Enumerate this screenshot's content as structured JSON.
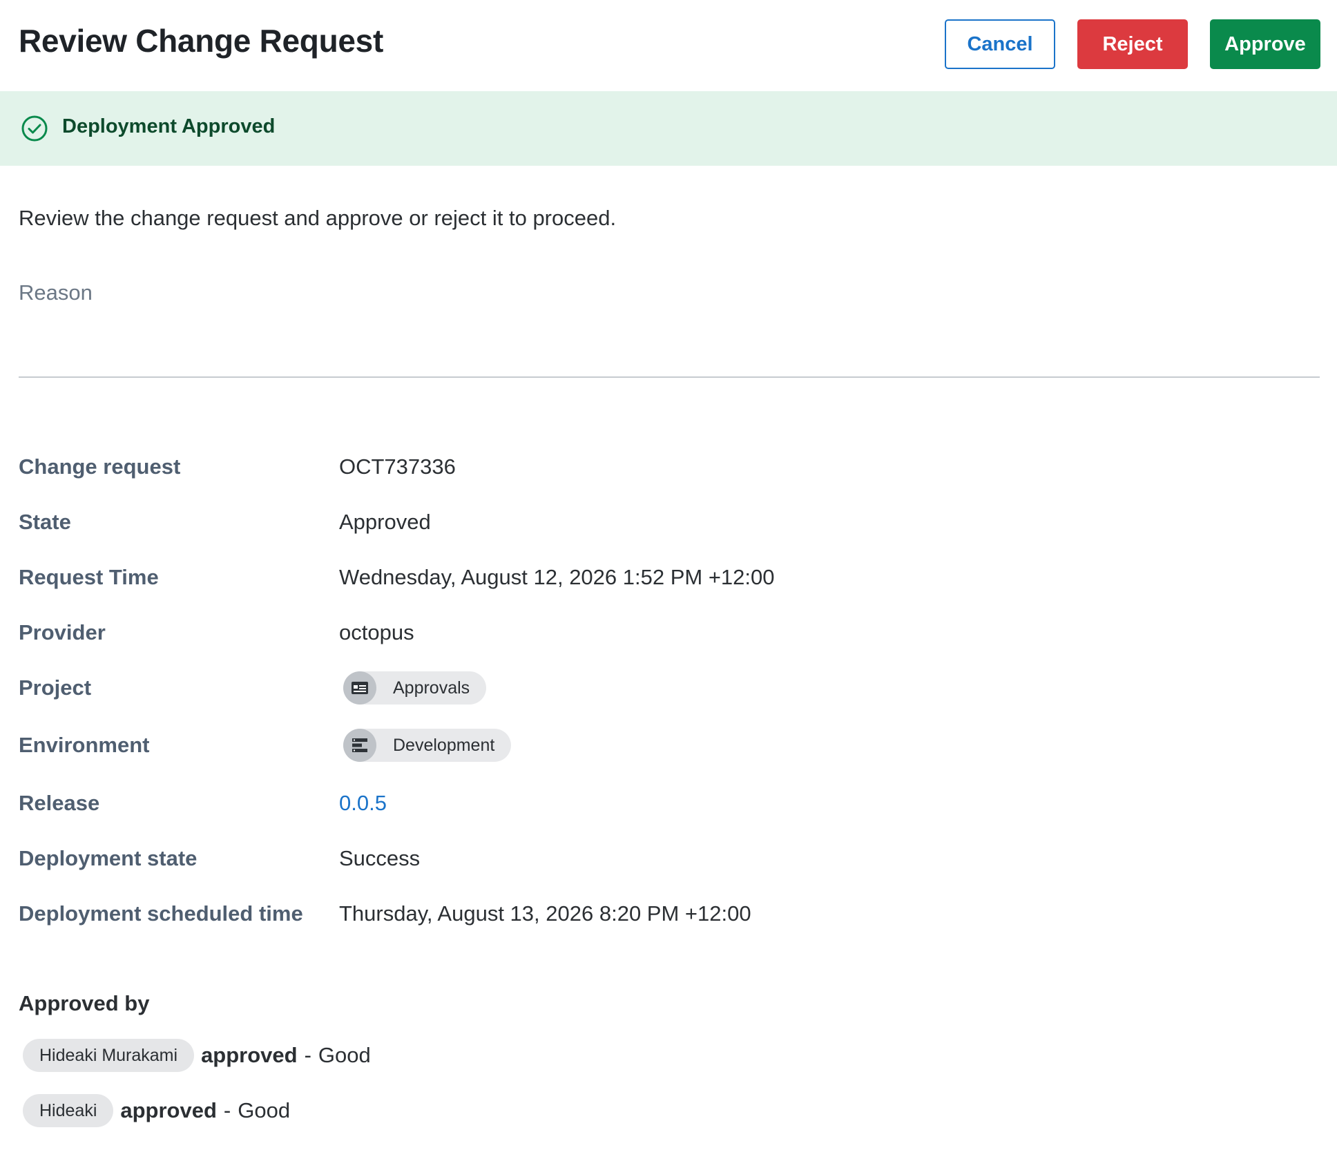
{
  "header": {
    "title": "Review Change Request",
    "cancel_label": "Cancel",
    "reject_label": "Reject",
    "approve_label": "Approve"
  },
  "banner": {
    "icon": "check-circle-icon",
    "text": "Deployment Approved"
  },
  "intro": "Review the change request and approve or reject it to proceed.",
  "reason": {
    "label": "Reason",
    "value": ""
  },
  "details": [
    {
      "label": "Change request",
      "value": "OCT737336"
    },
    {
      "label": "State",
      "value": "Approved"
    },
    {
      "label": "Request Time",
      "value": "Wednesday, August 12, 2026 1:52 PM +12:00"
    },
    {
      "label": "Provider",
      "value": "octopus"
    },
    {
      "label": "Project",
      "value": "Approvals",
      "icon": "project-card-icon"
    },
    {
      "label": "Environment",
      "value": "Development",
      "icon": "environment-server-icon"
    },
    {
      "label": "Release",
      "value": "0.0.5"
    },
    {
      "label": "Deployment state",
      "value": "Success"
    },
    {
      "label": "Deployment scheduled time",
      "value": "Thursday, August 13, 2026 8:20 PM +12:00"
    }
  ],
  "approved_by": {
    "title": "Approved by",
    "entries": [
      {
        "name": "Hideaki Murakami",
        "action": "approved",
        "separator": "-",
        "comment": "Good"
      },
      {
        "name": "Hideaki",
        "action": "approved",
        "separator": "-",
        "comment": "Good"
      }
    ]
  },
  "colors": {
    "accent": "#1a73c9",
    "reject": "#dc3a3f",
    "approve": "#0a8a4c",
    "banner_bg": "#e2f3ea",
    "banner_text": "#0d4a2c"
  }
}
